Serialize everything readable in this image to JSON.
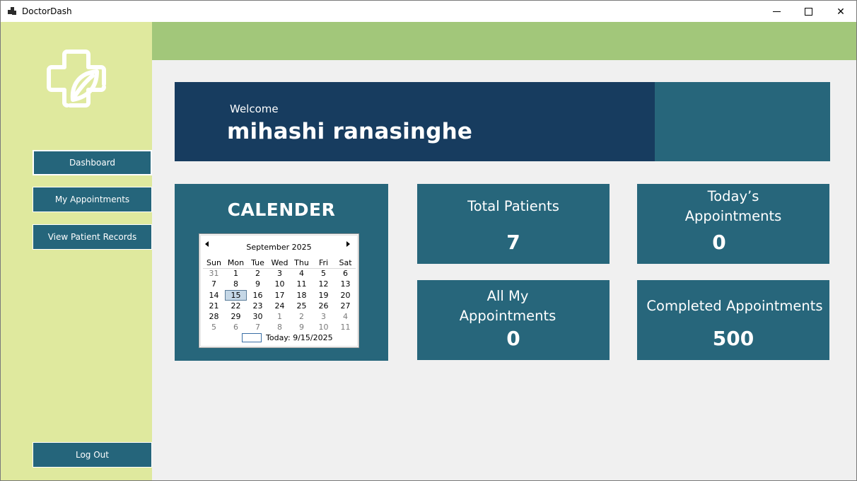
{
  "window": {
    "title": "DoctorDash",
    "minimize_label": "",
    "maximize_label": "",
    "close_label": "✕"
  },
  "sidebar": {
    "items": [
      {
        "label": "Dashboard"
      },
      {
        "label": "My Appointments"
      },
      {
        "label": "View Patient Records"
      }
    ],
    "logout_label": "Log Out"
  },
  "welcome": {
    "label": "Welcome",
    "name": "mihashi ranasinghe"
  },
  "calendar": {
    "title": "CALENDER",
    "month_label": "September 2025",
    "weekdays": [
      "Sun",
      "Mon",
      "Tue",
      "Wed",
      "Thu",
      "Fri",
      "Sat"
    ],
    "weeks": [
      [
        "31",
        "1",
        "2",
        "3",
        "4",
        "5",
        "6"
      ],
      [
        "7",
        "8",
        "9",
        "10",
        "11",
        "12",
        "13"
      ],
      [
        "14",
        "15",
        "16",
        "17",
        "18",
        "19",
        "20"
      ],
      [
        "21",
        "22",
        "23",
        "24",
        "25",
        "26",
        "27"
      ],
      [
        "28",
        "29",
        "30",
        "1",
        "2",
        "3",
        "4"
      ],
      [
        "5",
        "6",
        "7",
        "8",
        "9",
        "10",
        "11"
      ]
    ],
    "selected_day": "15",
    "today_label": "Today: 9/15/2025"
  },
  "stats": {
    "total_patients": {
      "title": "Total Patients",
      "value": "7"
    },
    "todays_appointments": {
      "title": "Today’s Appointments",
      "value": "0"
    },
    "all_my_appointments": {
      "title": "All My Appointments",
      "value": "0"
    },
    "completed_appointments": {
      "title": "Completed Appointments",
      "value": "500"
    }
  },
  "colors": {
    "sidebar_bg": "#dfe99e",
    "topbar_bg": "#a2c77a",
    "card_bg": "#27667b",
    "banner_bg": "#173c5f",
    "content_bg": "#f0f0f0"
  }
}
